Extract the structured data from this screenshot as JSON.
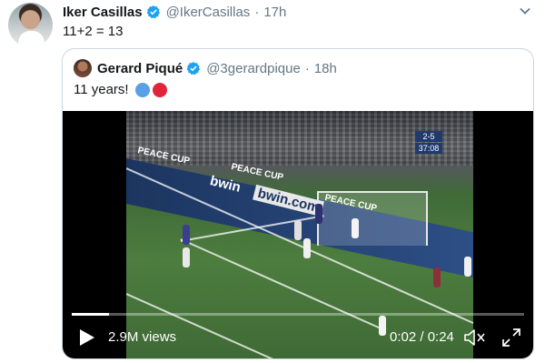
{
  "tweet": {
    "name": "Iker Casillas",
    "handle": "@IkerCasillas",
    "separator": "·",
    "time": "17h",
    "text": "11+2 = 13"
  },
  "quoted": {
    "name": "Gerard Piqué",
    "handle": "@3gerardpique",
    "separator": "·",
    "time": "18h",
    "text": "11 years!",
    "emoji_colors": [
      "#5aa0e6",
      "#e0243b"
    ]
  },
  "video": {
    "views": "2.9M views",
    "time": "0:02 / 0:24",
    "progress_fraction": 0.083,
    "scoreboard": [
      "2-5",
      "37:08"
    ],
    "ads": [
      "bwin",
      "bwin.com",
      "PEACE CUP",
      "PEACE CUP",
      "PEACE CUP"
    ]
  },
  "colors": {
    "verified": "#1da1f2",
    "handle": "#657786",
    "border": "#ccd6dd"
  }
}
